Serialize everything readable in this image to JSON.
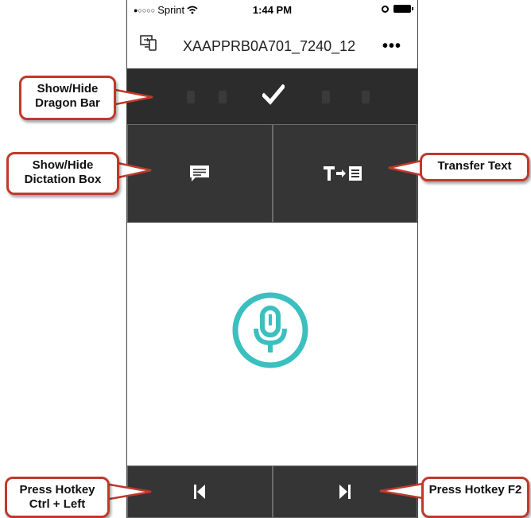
{
  "status_bar": {
    "signal": "●○○○○",
    "carrier": "Sprint",
    "time": "1:44 PM"
  },
  "title_bar": {
    "device_name": "XAAPPRB0A701_7240_12",
    "more_label": "•••"
  },
  "callouts": {
    "dragon_bar": "Show/Hide Dragon Bar",
    "dictation_box": "Show/Hide Dictation Box",
    "transfer_text": "Transfer Text",
    "ctrl_left": "Press Hotkey Ctrl + Left",
    "f2": "Press Hotkey F2"
  },
  "colors": {
    "panel": "#353535",
    "dragon_bar": "#2c2c2c",
    "mic_accent": "#3bbfbf",
    "callout_border": "#c0392b"
  },
  "icons": [
    "devices-icon",
    "more-icon",
    "checkmark-icon",
    "dictation-box-icon",
    "transfer-text-icon",
    "microphone-icon",
    "skip-previous-icon",
    "skip-next-icon",
    "wifi-icon",
    "alarm-icon",
    "battery-icon"
  ]
}
